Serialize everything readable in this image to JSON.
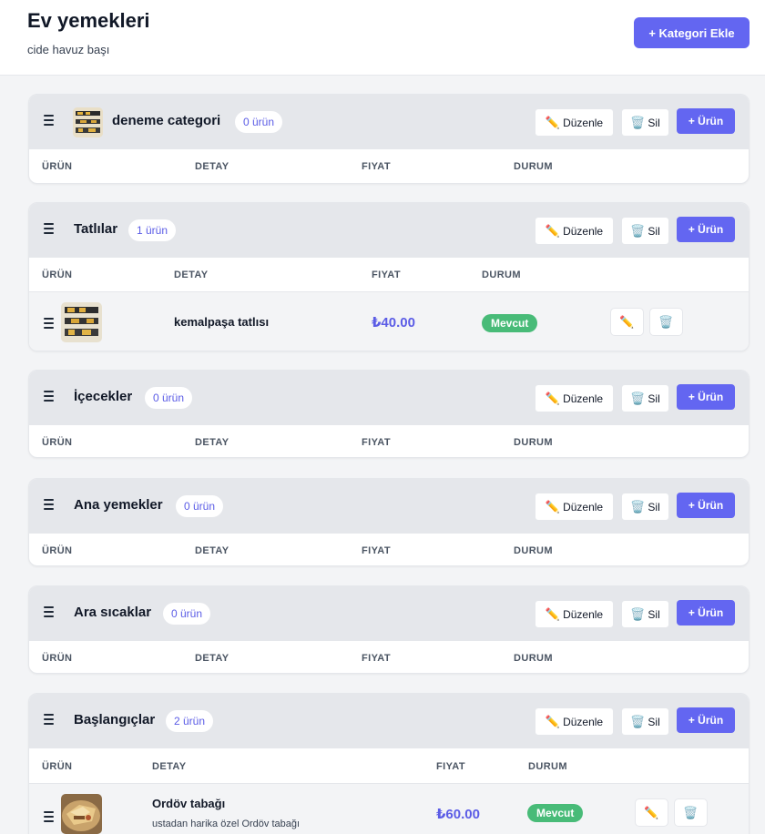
{
  "header": {
    "title": "Ev yemekleri",
    "subtitle": "cide havuz başı",
    "add_category_label": "+ Kategori Ekle"
  },
  "labels": {
    "edit": "Düzenle",
    "delete": "Sil",
    "add_product": "+ Ürün",
    "edit_icon": "✏️",
    "delete_icon": "🗑️"
  },
  "columns": [
    "ÜRÜN",
    "DETAY",
    "FIYAT",
    "DURUM"
  ],
  "categories": [
    {
      "name": "deneme categori",
      "count": "0 ürün",
      "has_image": true,
      "products": []
    },
    {
      "name": "Tatlılar",
      "count": "1 ürün",
      "has_image": false,
      "products": [
        {
          "name": "kemalpaşa tatlısı",
          "description": "",
          "price": "₺40.00",
          "status": "Mevcut"
        }
      ]
    },
    {
      "name": "İçecekler",
      "count": "0 ürün",
      "has_image": false,
      "products": []
    },
    {
      "name": "Ana yemekler",
      "count": "0 ürün",
      "has_image": false,
      "products": []
    },
    {
      "name": "Ara sıcaklar",
      "count": "0 ürün",
      "has_image": false,
      "products": []
    },
    {
      "name": "Başlangıçlar",
      "count": "2 ürün",
      "has_image": false,
      "products": [
        {
          "name": "Ordöv tabağı",
          "description": "ustadan harika özel Ordöv tabağı",
          "price": "₺60.00",
          "status": "Mevcut"
        }
      ]
    }
  ],
  "colors": {
    "accent": "#6366f1",
    "status_available": "#48bb78",
    "category_header": "#e5e7eb"
  },
  "icons": {
    "drag": "drag-handle-icon",
    "edit": "pencil-icon",
    "delete": "trash-icon"
  }
}
